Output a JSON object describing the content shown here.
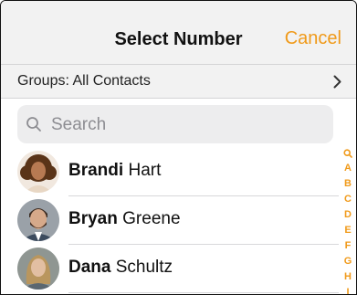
{
  "navbar": {
    "title": "Select Number",
    "cancel_label": "Cancel"
  },
  "groups": {
    "label": "Groups: All Contacts"
  },
  "search": {
    "placeholder": "Search"
  },
  "contacts": [
    {
      "first": "Brandi",
      "last": "Hart",
      "avatar": "woman-curly-hair-photo"
    },
    {
      "first": "Bryan",
      "last": "Greene",
      "avatar": "man-beard-photo"
    },
    {
      "first": "Dana",
      "last": "Schultz",
      "avatar": "woman-blonde-photo"
    }
  ],
  "index_letters": [
    "A",
    "B",
    "C",
    "D",
    "E",
    "F",
    "G",
    "H",
    "I"
  ],
  "colors": {
    "accent": "#f09a1a",
    "bar": "#f2f2f2",
    "search_bg": "#ededee"
  }
}
